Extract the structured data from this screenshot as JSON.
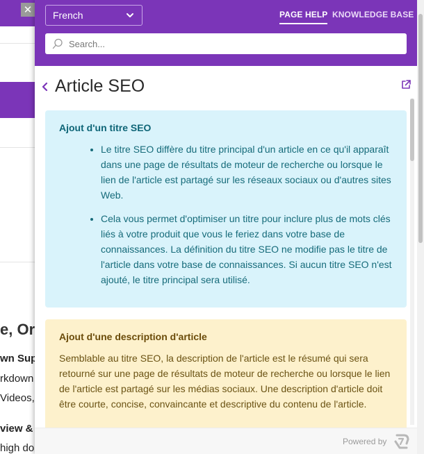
{
  "background": {
    "heading_fragment": "e, Org",
    "lines": [
      "wn Supp",
      "rkdown",
      "Videos,",
      "view & I",
      "high do"
    ]
  },
  "header": {
    "language": "French",
    "tabs": [
      {
        "label": "PAGE HELP",
        "active": true
      },
      {
        "label": "KNOWLEDGE BASE",
        "active": false
      }
    ],
    "search_placeholder": "Search..."
  },
  "article": {
    "title": "Article SEO",
    "sections": [
      {
        "type": "info",
        "heading": "Ajout d'un titre SEO",
        "bullets": [
          "Le titre SEO diffère du titre principal d'un article en ce qu'il apparaît dans une page de résultats de moteur de recherche ou lorsque le lien de l'article est partagé sur les réseaux sociaux ou d'autres sites Web.",
          "Cela vous permet d'optimiser un titre pour inclure plus de mots clés liés à votre produit que vous le feriez dans votre base de connaissances. La définition du titre SEO ne modifie pas le titre de l'article dans votre base de connaissances. Si aucun titre SEO n'est ajouté, le titre principal sera utilisé."
        ]
      },
      {
        "type": "warn",
        "heading": "Ajout d'une description d'article",
        "body": "Semblable au titre SEO, la description de l'article est le résumé qui sera retourné sur une page de résultats de moteur de recherche ou lorsque le lien de l'article est partagé sur les médias sociaux. Une description d'article doit être courte, concise, convaincante et descriptive du contenu de l'article."
      }
    ]
  },
  "footer": {
    "powered_by": "Powered by"
  },
  "colors": {
    "brand_purple": "#7b35b8",
    "info_bg": "#d9f3fb",
    "warn_bg": "#fdf1cc"
  }
}
